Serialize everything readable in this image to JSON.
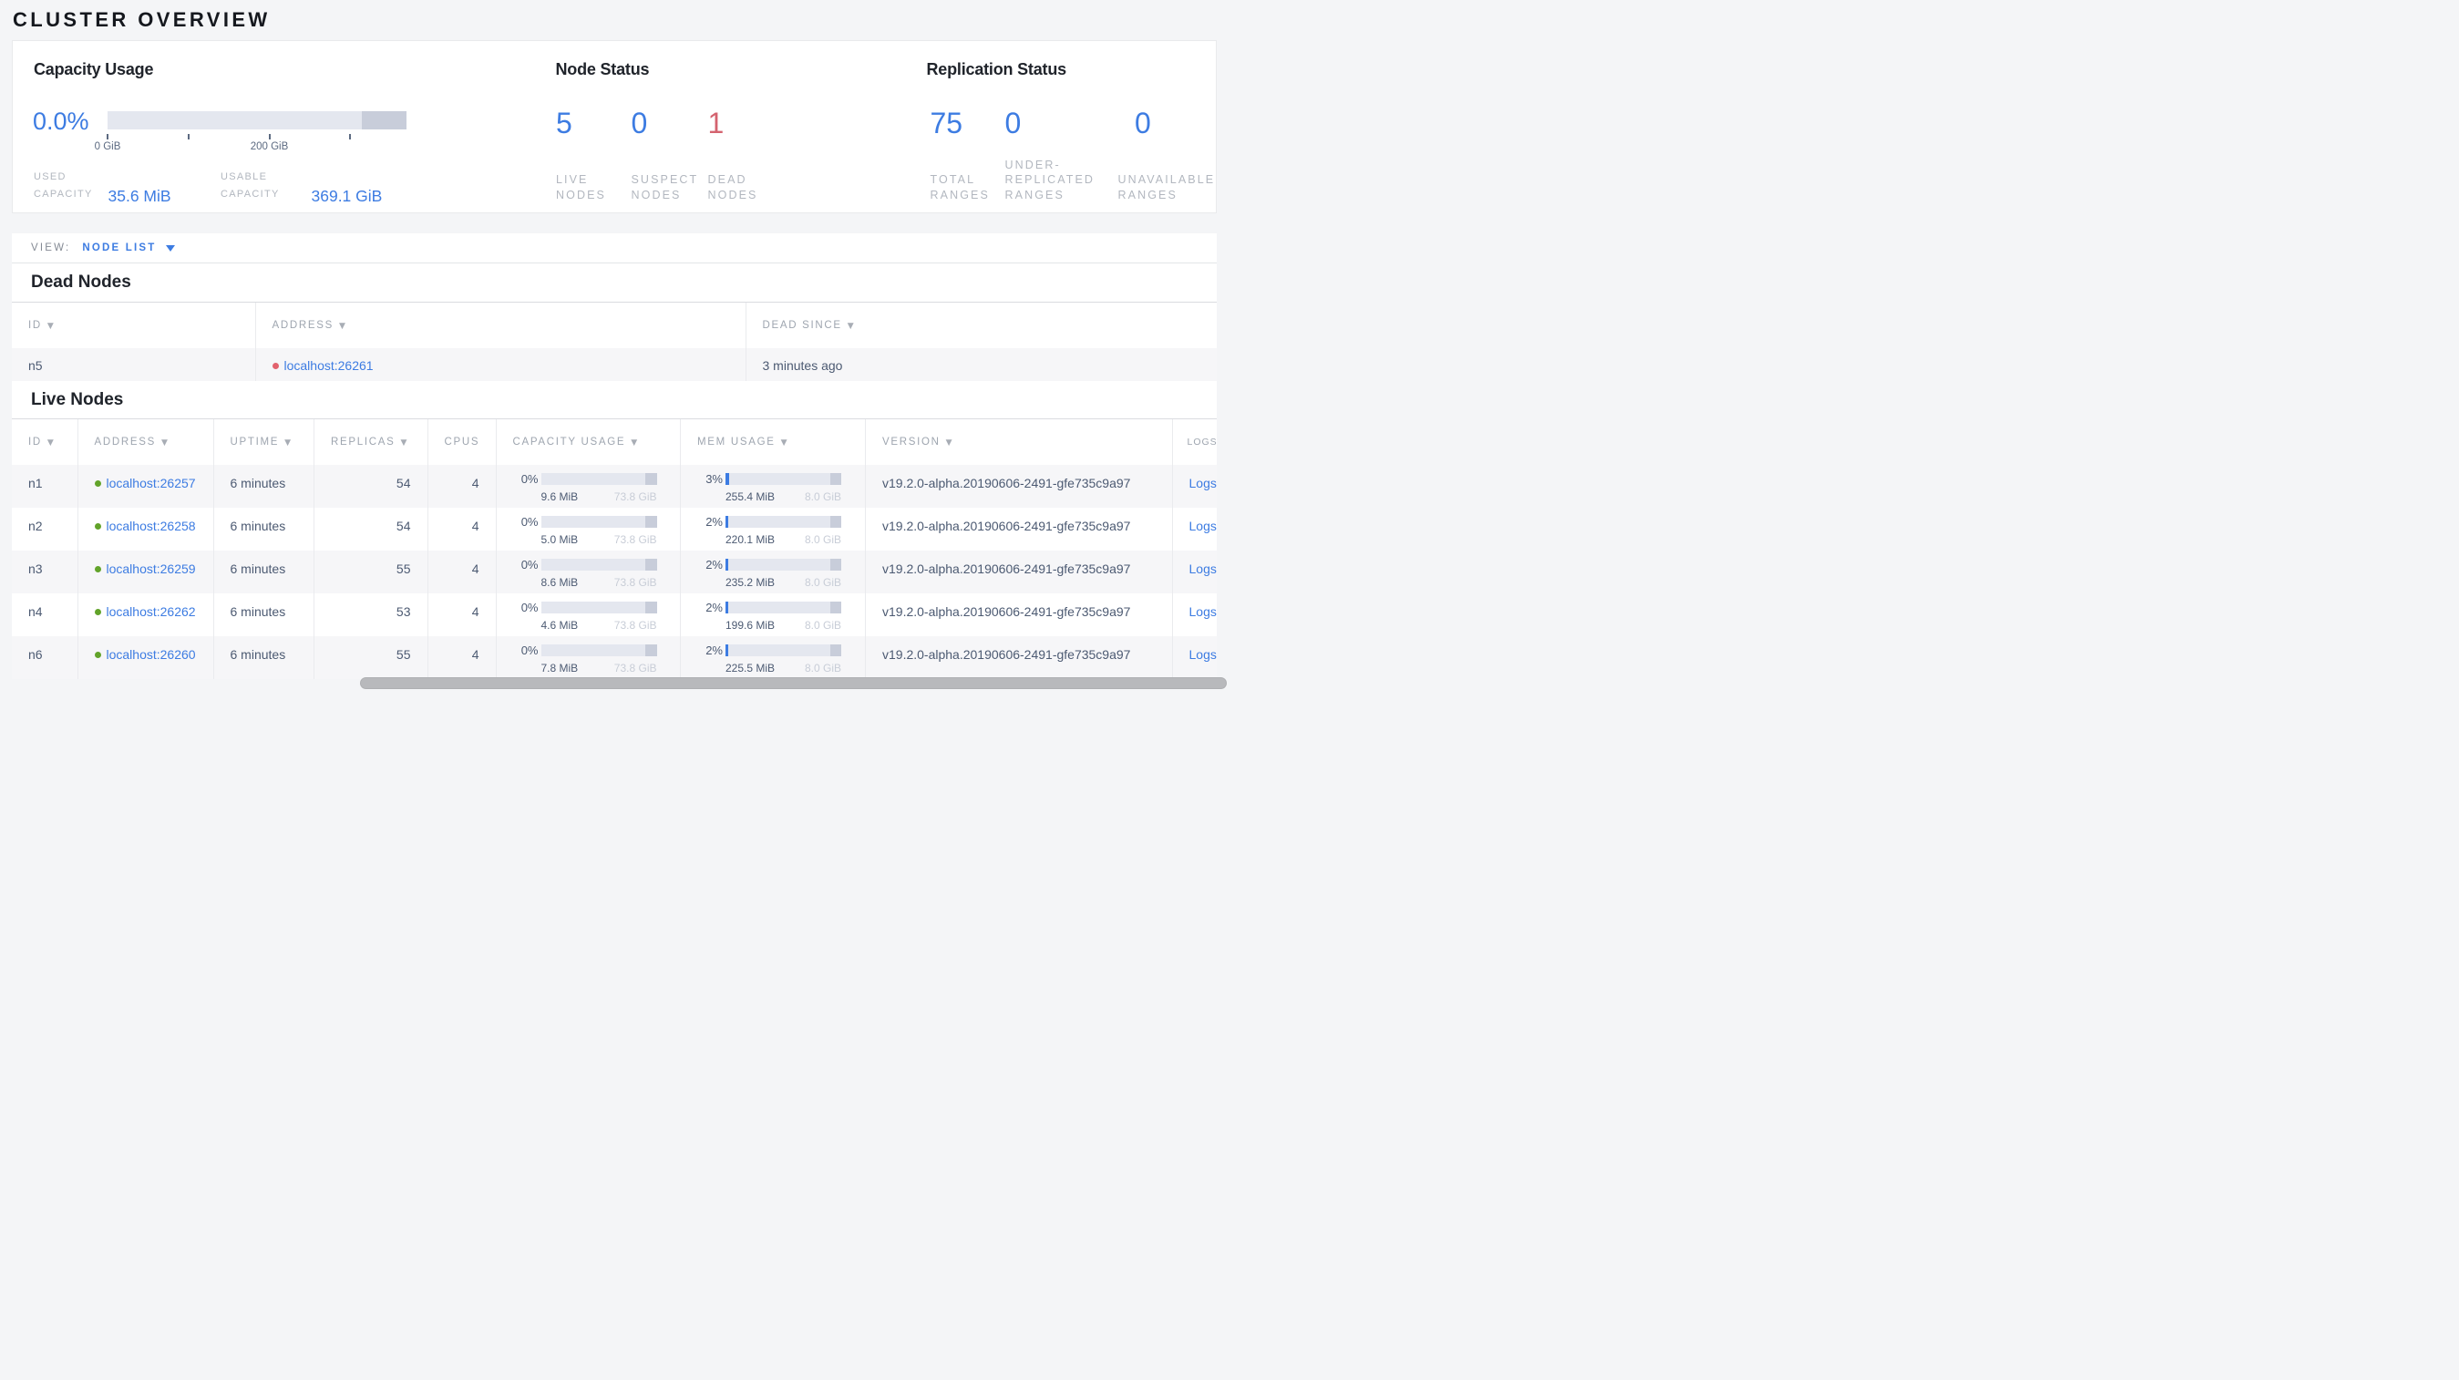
{
  "page_title": "CLUSTER OVERVIEW",
  "colors": {
    "accent_blue": "#3d7ce2",
    "danger_red": "#d4636f",
    "live_dot_green": "#62a32a",
    "dead_dot_red": "#e2626d"
  },
  "summary": {
    "capacity": {
      "title": "Capacity Usage",
      "percent": "0.0%",
      "ticks": [
        {
          "pct": 0,
          "label": "0 GiB"
        },
        {
          "pct": 27.06,
          "label": ""
        },
        {
          "pct": 54.12,
          "label": "200 GiB"
        },
        {
          "pct": 81.18,
          "label": ""
        }
      ],
      "stats": [
        {
          "label": "USED\nCAPACITY",
          "value": "35.6 MiB"
        },
        {
          "label": "USABLE\nCAPACITY",
          "value": "369.1 GiB"
        }
      ]
    },
    "node_status": {
      "title": "Node Status",
      "items": [
        {
          "value": "5",
          "label": "LIVE\nNODES",
          "state": "live"
        },
        {
          "value": "0",
          "label": "SUSPECT\nNODES",
          "state": "suspect"
        },
        {
          "value": "1",
          "label": "DEAD\nNODES",
          "state": "dead"
        }
      ]
    },
    "replication_status": {
      "title": "Replication Status",
      "items": [
        {
          "value": "75",
          "label": "TOTAL\nRANGES",
          "state": "total"
        },
        {
          "value": "0",
          "label": "UNDER-\nREPLICATED\nRANGES",
          "state": "under-replicated"
        },
        {
          "value": "0",
          "label": "UNAVAILABLE\nRANGES",
          "state": "unavailable"
        }
      ]
    }
  },
  "view_bar": {
    "label": "VIEW:",
    "selected": "NODE LIST"
  },
  "dead_nodes": {
    "title": "Dead Nodes",
    "columns": [
      {
        "label": "ID",
        "sortable": true
      },
      {
        "label": "ADDRESS",
        "sortable": true
      },
      {
        "label": "DEAD SINCE",
        "sortable": true
      }
    ],
    "rows": [
      {
        "id": "n5",
        "address": "localhost:26261",
        "status": "dead",
        "dead_since": "3 minutes ago"
      }
    ]
  },
  "live_nodes": {
    "title": "Live Nodes",
    "columns": [
      {
        "label": "ID",
        "sortable": true
      },
      {
        "label": "ADDRESS",
        "sortable": true
      },
      {
        "label": "UPTIME",
        "sortable": true
      },
      {
        "label": "REPLICAS",
        "sortable": true
      },
      {
        "label": "CPUS",
        "sortable": false
      },
      {
        "label": "CAPACITY USAGE",
        "sortable": true
      },
      {
        "label": "MEM USAGE",
        "sortable": true
      },
      {
        "label": "VERSION",
        "sortable": true
      },
      {
        "label": "LOGS",
        "sortable": false
      }
    ],
    "rows": [
      {
        "id": "n1",
        "address": "localhost:26257",
        "status": "live",
        "uptime": "6 minutes",
        "replicas": "54",
        "cpus": "4",
        "capacity": {
          "percent": "0%",
          "fill": 0,
          "used": "9.6 MiB",
          "total": "73.8 GiB"
        },
        "memory": {
          "percent": "3%",
          "fill": 3,
          "used": "255.4 MiB",
          "total": "8.0 GiB"
        },
        "version": "v19.2.0-alpha.20190606-2491-gfe735c9a97",
        "logs": "Logs"
      },
      {
        "id": "n2",
        "address": "localhost:26258",
        "status": "live",
        "uptime": "6 minutes",
        "replicas": "54",
        "cpus": "4",
        "capacity": {
          "percent": "0%",
          "fill": 0,
          "used": "5.0 MiB",
          "total": "73.8 GiB"
        },
        "memory": {
          "percent": "2%",
          "fill": 2,
          "used": "220.1 MiB",
          "total": "8.0 GiB"
        },
        "version": "v19.2.0-alpha.20190606-2491-gfe735c9a97",
        "logs": "Logs"
      },
      {
        "id": "n3",
        "address": "localhost:26259",
        "status": "live",
        "uptime": "6 minutes",
        "replicas": "55",
        "cpus": "4",
        "capacity": {
          "percent": "0%",
          "fill": 0,
          "used": "8.6 MiB",
          "total": "73.8 GiB"
        },
        "memory": {
          "percent": "2%",
          "fill": 2,
          "used": "235.2 MiB",
          "total": "8.0 GiB"
        },
        "version": "v19.2.0-alpha.20190606-2491-gfe735c9a97",
        "logs": "Logs"
      },
      {
        "id": "n4",
        "address": "localhost:26262",
        "status": "live",
        "uptime": "6 minutes",
        "replicas": "53",
        "cpus": "4",
        "capacity": {
          "percent": "0%",
          "fill": 0,
          "used": "4.6 MiB",
          "total": "73.8 GiB"
        },
        "memory": {
          "percent": "2%",
          "fill": 2,
          "used": "199.6 MiB",
          "total": "8.0 GiB"
        },
        "version": "v19.2.0-alpha.20190606-2491-gfe735c9a97",
        "logs": "Logs"
      },
      {
        "id": "n6",
        "address": "localhost:26260",
        "status": "live",
        "uptime": "6 minutes",
        "replicas": "55",
        "cpus": "4",
        "capacity": {
          "percent": "0%",
          "fill": 0,
          "used": "7.8 MiB",
          "total": "73.8 GiB"
        },
        "memory": {
          "percent": "2%",
          "fill": 2,
          "used": "225.5 MiB",
          "total": "8.0 GiB"
        },
        "version": "v19.2.0-alpha.20190606-2491-gfe735c9a97",
        "logs": "Logs"
      }
    ]
  }
}
